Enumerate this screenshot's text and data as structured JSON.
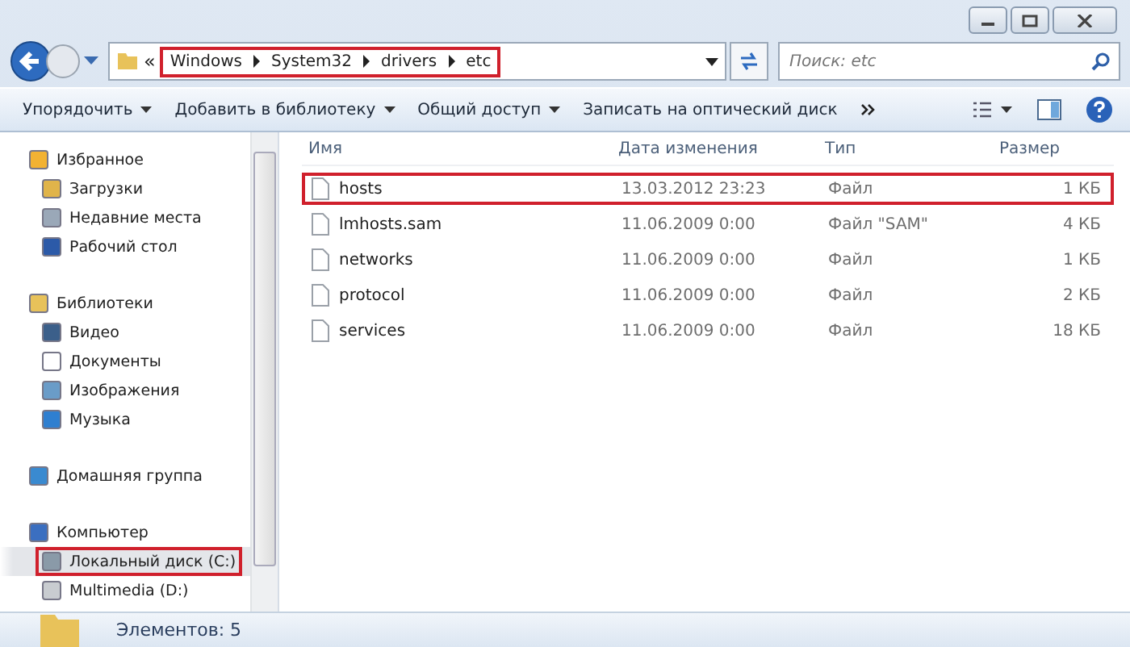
{
  "address": {
    "overflow": "«",
    "path": [
      "Windows",
      "System32",
      "drivers",
      "etc"
    ],
    "highlighted": true
  },
  "search": {
    "placeholder": "Поиск: etc"
  },
  "toolbar": [
    "Упорядочить",
    "Добавить в библиотеку",
    "Общий доступ",
    "Записать на оптический диск"
  ],
  "sidebar": {
    "groups": [
      {
        "label": "Избранное",
        "children": [
          {
            "label": "Загрузки",
            "selected": false,
            "highlighted": false
          },
          {
            "label": "Недавние места",
            "selected": false,
            "highlighted": false
          },
          {
            "label": "Рабочий стол",
            "selected": false,
            "highlighted": false
          }
        ]
      },
      {
        "label": "Библиотеки",
        "children": [
          {
            "label": "Видео",
            "selected": false,
            "highlighted": false
          },
          {
            "label": "Документы",
            "selected": false,
            "highlighted": false
          },
          {
            "label": "Изображения",
            "selected": false,
            "highlighted": false
          },
          {
            "label": "Музыка",
            "selected": false,
            "highlighted": false
          }
        ]
      },
      {
        "label": "Домашняя группа"
      },
      {
        "label": "Компьютер",
        "children": [
          {
            "label": "Локальный диск (C:)",
            "selected": true,
            "highlighted": true
          },
          {
            "label": "Multimedia (D:)",
            "selected": false,
            "highlighted": false
          }
        ]
      }
    ]
  },
  "table": {
    "columns": [
      "Имя",
      "Дата изменения",
      "Тип",
      "Размер"
    ],
    "rows": [
      {
        "name": "hosts",
        "date": "13.03.2012 23:23",
        "type": "Файл",
        "size": "1 КБ",
        "highlighted": true
      },
      {
        "name": "lmhosts.sam",
        "date": "11.06.2009 0:00",
        "type": "Файл \"SAM\"",
        "size": "4 КБ",
        "highlighted": false
      },
      {
        "name": "networks",
        "date": "11.06.2009 0:00",
        "type": "Файл",
        "size": "1 КБ",
        "highlighted": false
      },
      {
        "name": "protocol",
        "date": "11.06.2009 0:00",
        "type": "Файл",
        "size": "2 КБ",
        "highlighted": false
      },
      {
        "name": "services",
        "date": "11.06.2009 0:00",
        "type": "Файл",
        "size": "18 КБ",
        "highlighted": false
      }
    ]
  },
  "status_bar": {
    "text": "Элементов: 5"
  }
}
